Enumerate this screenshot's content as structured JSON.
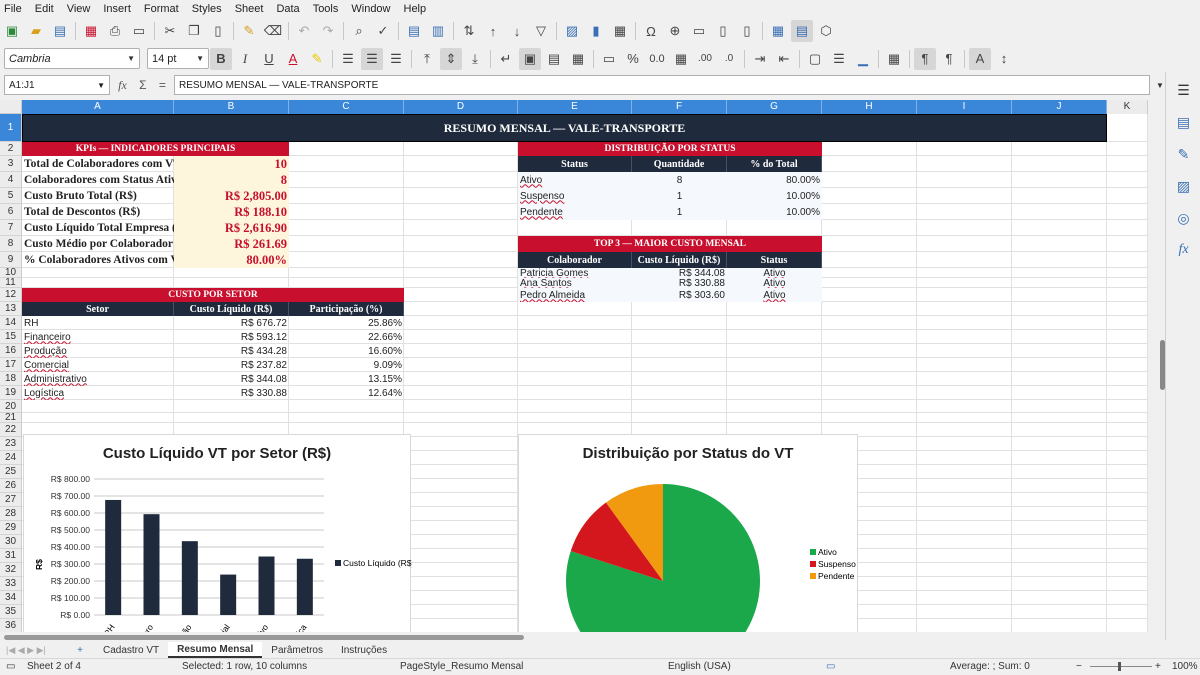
{
  "menu": [
    "File",
    "Edit",
    "View",
    "Insert",
    "Format",
    "Styles",
    "Sheet",
    "Data",
    "Tools",
    "Window",
    "Help"
  ],
  "font": {
    "name": "Cambria",
    "size": "14 pt"
  },
  "namebox": "A1:J1",
  "formula": "RESUMO MENSAL — VALE-TRANSPORTE",
  "columns": [
    "A",
    "B",
    "C",
    "D",
    "E",
    "F",
    "G",
    "H",
    "I",
    "J",
    "K"
  ],
  "rows": [
    "1",
    "2",
    "3",
    "4",
    "5",
    "6",
    "7",
    "8",
    "9",
    "10",
    "11",
    "12",
    "13",
    "14",
    "15",
    "16",
    "17",
    "18",
    "19",
    "20",
    "21",
    "22",
    "23",
    "24",
    "25",
    "26",
    "27",
    "28",
    "29",
    "30",
    "31",
    "32",
    "33",
    "34",
    "35",
    "36"
  ],
  "title": "RESUMO MENSAL — VALE-TRANSPORTE",
  "kpis": {
    "header": "KPIs — INDICADORES PRINCIPAIS",
    "items": [
      {
        "label": "Total de Colaboradores com VT",
        "value": "10"
      },
      {
        "label": "Colaboradores com Status Ativo",
        "value": "8"
      },
      {
        "label": "Custo Bruto Total (R$)",
        "value": "R$ 2,805.00"
      },
      {
        "label": "Total de Descontos (R$)",
        "value": "R$ 188.10"
      },
      {
        "label": "Custo Líquido Total Empresa (R$)",
        "value": "R$ 2,616.90"
      },
      {
        "label": "Custo Médio por Colaborador (R$)",
        "value": "R$ 261.69"
      },
      {
        "label": "% Colaboradores Ativos com VT",
        "value": "80.00%"
      }
    ]
  },
  "status_dist": {
    "header": "DISTRIBUIÇÃO POR STATUS",
    "cols": [
      "Status",
      "Quantidade",
      "% do Total"
    ],
    "rows": [
      [
        "Ativo",
        "8",
        "80.00%"
      ],
      [
        "Suspenso",
        "1",
        "10.00%"
      ],
      [
        "Pendente",
        "1",
        "10.00%"
      ]
    ]
  },
  "top3": {
    "header": "TOP 3 — MAIOR CUSTO MENSAL",
    "cols": [
      "Colaborador",
      "Custo Líquido (R$)",
      "Status"
    ],
    "rows": [
      [
        "Patricia Gomes",
        "R$ 344.08",
        "Ativo"
      ],
      [
        "Ana Santos",
        "R$ 330.88",
        "Ativo"
      ],
      [
        "Pedro Almeida",
        "R$ 303.60",
        "Ativo"
      ]
    ]
  },
  "sector": {
    "header": "CUSTO POR SETOR",
    "cols": [
      "Setor",
      "Custo Líquido (R$)",
      "Participação (%)"
    ],
    "rows": [
      [
        "RH",
        "R$ 676.72",
        "25.86%"
      ],
      [
        "Financeiro",
        "R$ 593.12",
        "22.66%"
      ],
      [
        "Produção",
        "R$ 434.28",
        "16.60%"
      ],
      [
        "Comercial",
        "R$ 237.82",
        "9.09%"
      ],
      [
        "Administrativo",
        "R$ 344.08",
        "13.15%"
      ],
      [
        "Logística",
        "R$ 330.88",
        "12.64%"
      ]
    ]
  },
  "chart_data": [
    {
      "type": "bar",
      "title": "Custo Líquido VT por Setor (R$)",
      "ylabel": "R$",
      "categories": [
        "RH",
        "Financeiro",
        "Produção",
        "Comercial",
        "Administrativo",
        "Logística"
      ],
      "category_labels_visible": [
        "RH",
        "ero",
        "ção",
        "rcial",
        "tivo",
        "ística"
      ],
      "series": [
        {
          "name": "Custo Líquido (R$)",
          "values": [
            676.72,
            593.12,
            434.28,
            237.82,
            344.08,
            330.88
          ]
        }
      ],
      "ylim": [
        0,
        800
      ],
      "yticks": [
        "R$ 0.00",
        "R$ 100.00",
        "R$ 200.00",
        "R$ 300.00",
        "R$ 400.00",
        "R$ 500.00",
        "R$ 600.00",
        "R$ 700.00",
        "R$ 800.00"
      ],
      "grid": true,
      "legend": "right",
      "color": "#1f2a3d"
    },
    {
      "type": "pie",
      "title": "Distribuição por Status do VT",
      "categories": [
        "Ativo",
        "Suspenso",
        "Pendente"
      ],
      "values": [
        8,
        1,
        1
      ],
      "colors": [
        "#1aa84b",
        "#d4171c",
        "#f29a0f"
      ],
      "legend": "right"
    }
  ],
  "sheets": [
    "Cadastro VT",
    "Resumo Mensal",
    "Parâmetros",
    "Instruções"
  ],
  "active_sheet": "Resumo Mensal",
  "status": {
    "sheet": "Sheet 2 of 4",
    "selection": "Selected: 1 row, 10 columns",
    "pagestyle": "PageStyle_Resumo Mensal",
    "lang": "English (USA)",
    "summary": "Average: ; Sum: 0",
    "zoom": "100%"
  }
}
